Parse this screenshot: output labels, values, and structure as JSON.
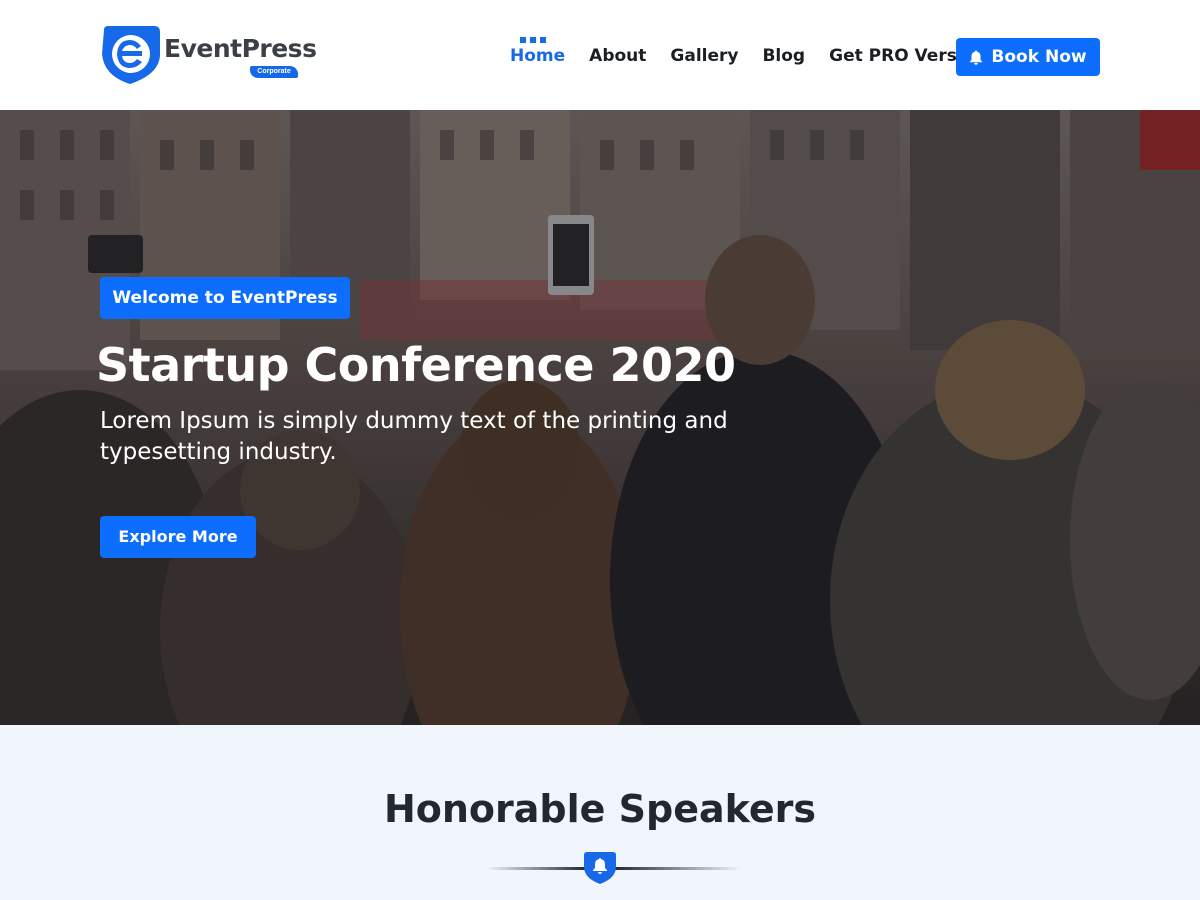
{
  "header": {
    "logo": {
      "name": "EventPress",
      "tagline": "Corporate"
    },
    "nav": [
      {
        "label": "Home",
        "active": true
      },
      {
        "label": "About",
        "active": false
      },
      {
        "label": "Gallery",
        "active": false
      },
      {
        "label": "Blog",
        "active": false
      },
      {
        "label": "Get PRO Version",
        "active": false
      }
    ],
    "book_button": {
      "label": "Book Now",
      "icon": "bell-icon"
    }
  },
  "hero": {
    "badge": "Welcome to EventPress",
    "title": "Startup Conference 2020",
    "description": "Lorem Ipsum is simply dummy text of the printing and typesetting industry.",
    "cta": "Explore More",
    "background": "crowd-photo"
  },
  "speakers": {
    "title": "Honorable Speakers",
    "divider_icon": "bell-icon"
  },
  "colors": {
    "primary": "#0d6efd",
    "text_dark": "#1b1f24",
    "section_bg": "#f1f6fd"
  }
}
